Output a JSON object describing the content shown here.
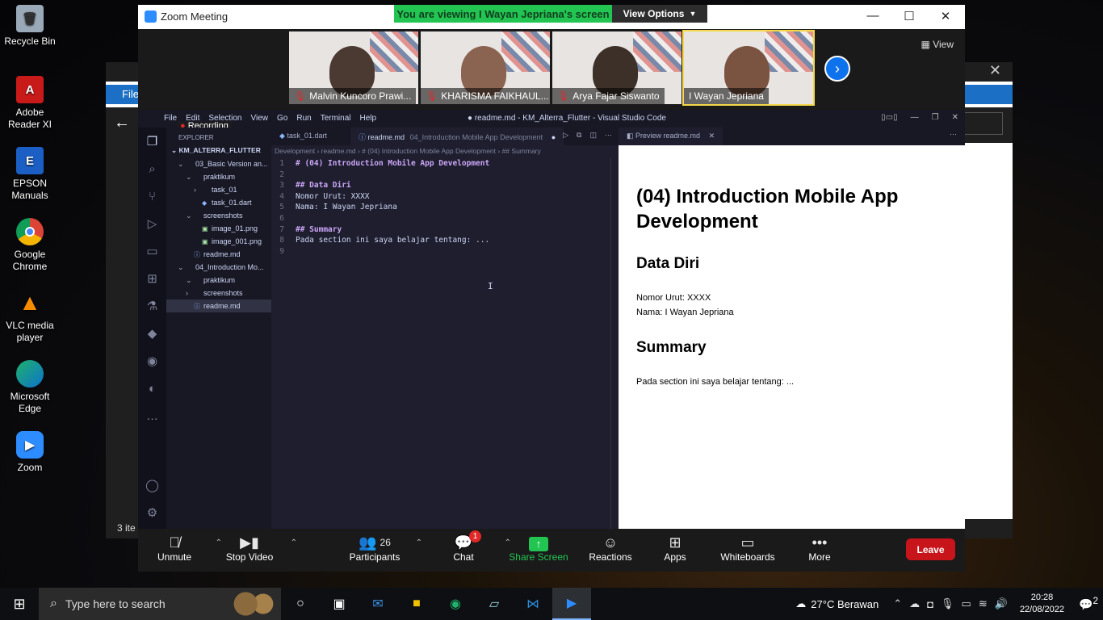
{
  "desktop": {
    "icons": [
      {
        "name": "recycle-bin",
        "label": "Recycle Bin"
      },
      {
        "name": "adobe-reader",
        "label": "Adobe Reader XI"
      },
      {
        "name": "epson-manuals",
        "label": "EPSON Manuals"
      },
      {
        "name": "google-chrome",
        "label": "Google Chrome"
      },
      {
        "name": "vlc",
        "label": "VLC media player"
      },
      {
        "name": "edge",
        "label": "Microsoft Edge"
      },
      {
        "name": "zoom",
        "label": "Zoom"
      }
    ]
  },
  "explorer_bg": {
    "file_tab": "File",
    "status": "3 ite"
  },
  "zoom": {
    "window_title": "Zoom Meeting",
    "banner": "You are viewing I Wayan Jepriana's screen",
    "view_options": "View Options",
    "view_label": "View",
    "participants": [
      {
        "name": "Malvin Kuncoro Prawi..."
      },
      {
        "name": "KHARISMA FAIKHAUL..."
      },
      {
        "name": "Arya Fajar Siswanto"
      },
      {
        "name": "I Wayan Jepriana"
      }
    ],
    "toolbar": {
      "unmute": "Unmute",
      "stop_video": "Stop Video",
      "participants": "Participants",
      "participants_count": "26",
      "chat": "Chat",
      "chat_badge": "1",
      "share_screen": "Share Screen",
      "reactions": "Reactions",
      "apps": "Apps",
      "whiteboards": "Whiteboards",
      "more": "More",
      "leave": "Leave"
    }
  },
  "vscode": {
    "menu": [
      "File",
      "Edit",
      "Selection",
      "View",
      "Go",
      "Run",
      "Terminal",
      "Help"
    ],
    "window_title": "● readme.md - KM_Alterra_Flutter - Visual Studio Code",
    "recording": "Recording",
    "explorer_header": "EXPLORER",
    "root": "KM_ALTERRA_FLUTTER",
    "tree": [
      {
        "label": "03_Basic Version an...",
        "indent": 1,
        "type": "folder-open"
      },
      {
        "label": "praktikum",
        "indent": 2,
        "type": "folder-open"
      },
      {
        "label": "task_01",
        "indent": 3,
        "type": "folder-closed"
      },
      {
        "label": "task_01.dart",
        "indent": 3,
        "type": "dart"
      },
      {
        "label": "screenshots",
        "indent": 2,
        "type": "folder-open"
      },
      {
        "label": "image_01.png",
        "indent": 3,
        "type": "image"
      },
      {
        "label": "image_001.png",
        "indent": 3,
        "type": "image"
      },
      {
        "label": "readme.md",
        "indent": 2,
        "type": "info"
      },
      {
        "label": "04_Introduction Mo...",
        "indent": 1,
        "type": "folder-open"
      },
      {
        "label": "praktikum",
        "indent": 2,
        "type": "folder-open"
      },
      {
        "label": "screenshots",
        "indent": 2,
        "type": "folder-closed"
      },
      {
        "label": "readme.md",
        "indent": 2,
        "type": "info",
        "selected": true
      }
    ],
    "tabs": [
      {
        "label": "task_01.dart"
      },
      {
        "label": "readme.md",
        "path": "04_Introduction Mobile App Development"
      }
    ],
    "breadcrumb": "Development  ›  readme.md  ›  # (04) Introduction Mobile App Development  ›  ## Summary",
    "code": [
      {
        "n": "1",
        "text": "# (04) Introduction Mobile App Development",
        "kind": "h"
      },
      {
        "n": "2",
        "text": "",
        "kind": "t"
      },
      {
        "n": "3",
        "text": "## Data Diri",
        "kind": "h"
      },
      {
        "n": "4",
        "text": "Nomor Urut: XXXX",
        "kind": "t"
      },
      {
        "n": "5",
        "text": "Nama: I Wayan Jepriana",
        "kind": "t"
      },
      {
        "n": "6",
        "text": "",
        "kind": "t"
      },
      {
        "n": "7",
        "text": "## Summary",
        "kind": "h"
      },
      {
        "n": "8",
        "text": "Pada section ini saya belajar tentang: ...",
        "kind": "t"
      },
      {
        "n": "9",
        "text": "",
        "kind": "t"
      }
    ],
    "preview_tab": "Preview readme.md",
    "preview": {
      "h1": "(04) Introduction Mobile App Development",
      "h2_data": "Data Diri",
      "nomor": "Nomor Urut: XXXX",
      "nama": "Nama: I Wayan Jepriana",
      "h2_summary": "Summary",
      "summary": "Pada section ini saya belajar tentang: ..."
    }
  },
  "taskbar": {
    "search_placeholder": "Type here to search",
    "weather": "27°C  Berawan",
    "time": "20:28",
    "date": "22/08/2022",
    "notifications": "2"
  }
}
